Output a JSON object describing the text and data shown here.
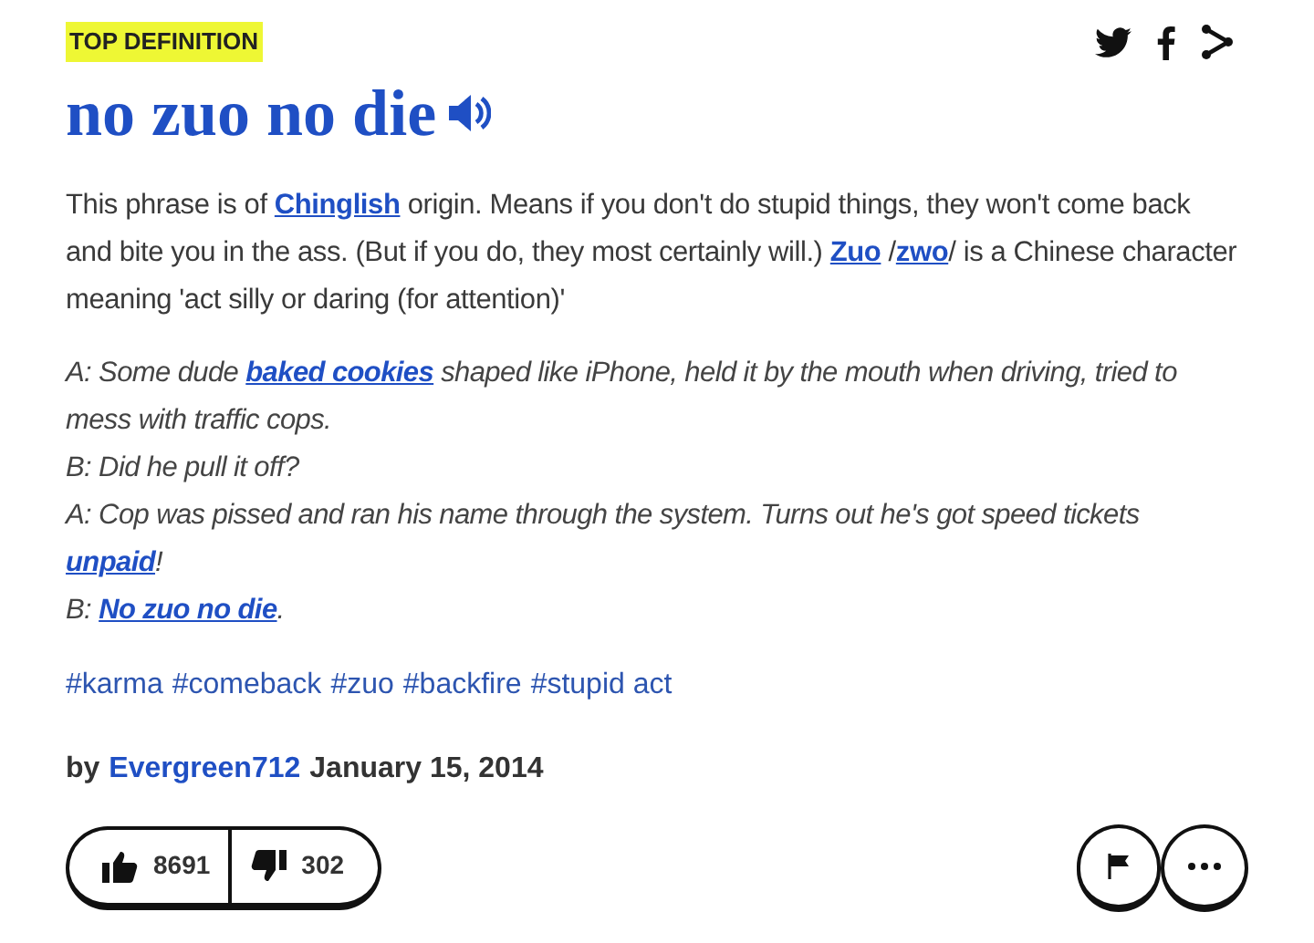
{
  "badge": "TOP DEFINITION",
  "title": "no zuo no die",
  "description": [
    {
      "text": "This phrase is of ",
      "link": false
    },
    {
      "text": "Chinglish",
      "link": true
    },
    {
      "text": " origin. Means if you don't do stupid things, they won't come back and bite you in the ass. (But if you do, they most certainly will.) ",
      "link": false
    },
    {
      "text": "Zuo",
      "link": true
    },
    {
      "text": " /",
      "link": false
    },
    {
      "text": "zwo",
      "link": true
    },
    {
      "text": "/ is a Chinese character meaning 'act silly or daring (for attention)'",
      "link": false
    }
  ],
  "example": [
    [
      {
        "text": "A: Some dude ",
        "link": false
      },
      {
        "text": "baked cookies",
        "link": true
      },
      {
        "text": " shaped like iPhone, held it by the mouth when driving, tried to mess with traffic cops.",
        "link": false
      }
    ],
    [
      {
        "text": "B: Did he pull it off?",
        "link": false
      }
    ],
    [
      {
        "text": "A: Cop was pissed and ran his name through the system. Turns out he's got speed tickets ",
        "link": false
      },
      {
        "text": "unpaid",
        "link": true
      },
      {
        "text": "!",
        "link": false
      }
    ],
    [
      {
        "text": "B: ",
        "link": false
      },
      {
        "text": "No zuo no die",
        "link": true
      },
      {
        "text": ".",
        "link": false
      }
    ]
  ],
  "tags": [
    "#karma",
    "#comeback",
    "#zuo",
    "#backfire",
    "#stupid act"
  ],
  "byline": {
    "by": "by",
    "author": "Evergreen712",
    "date": "January 15, 2014"
  },
  "votes": {
    "up": "8691",
    "down": "302"
  }
}
